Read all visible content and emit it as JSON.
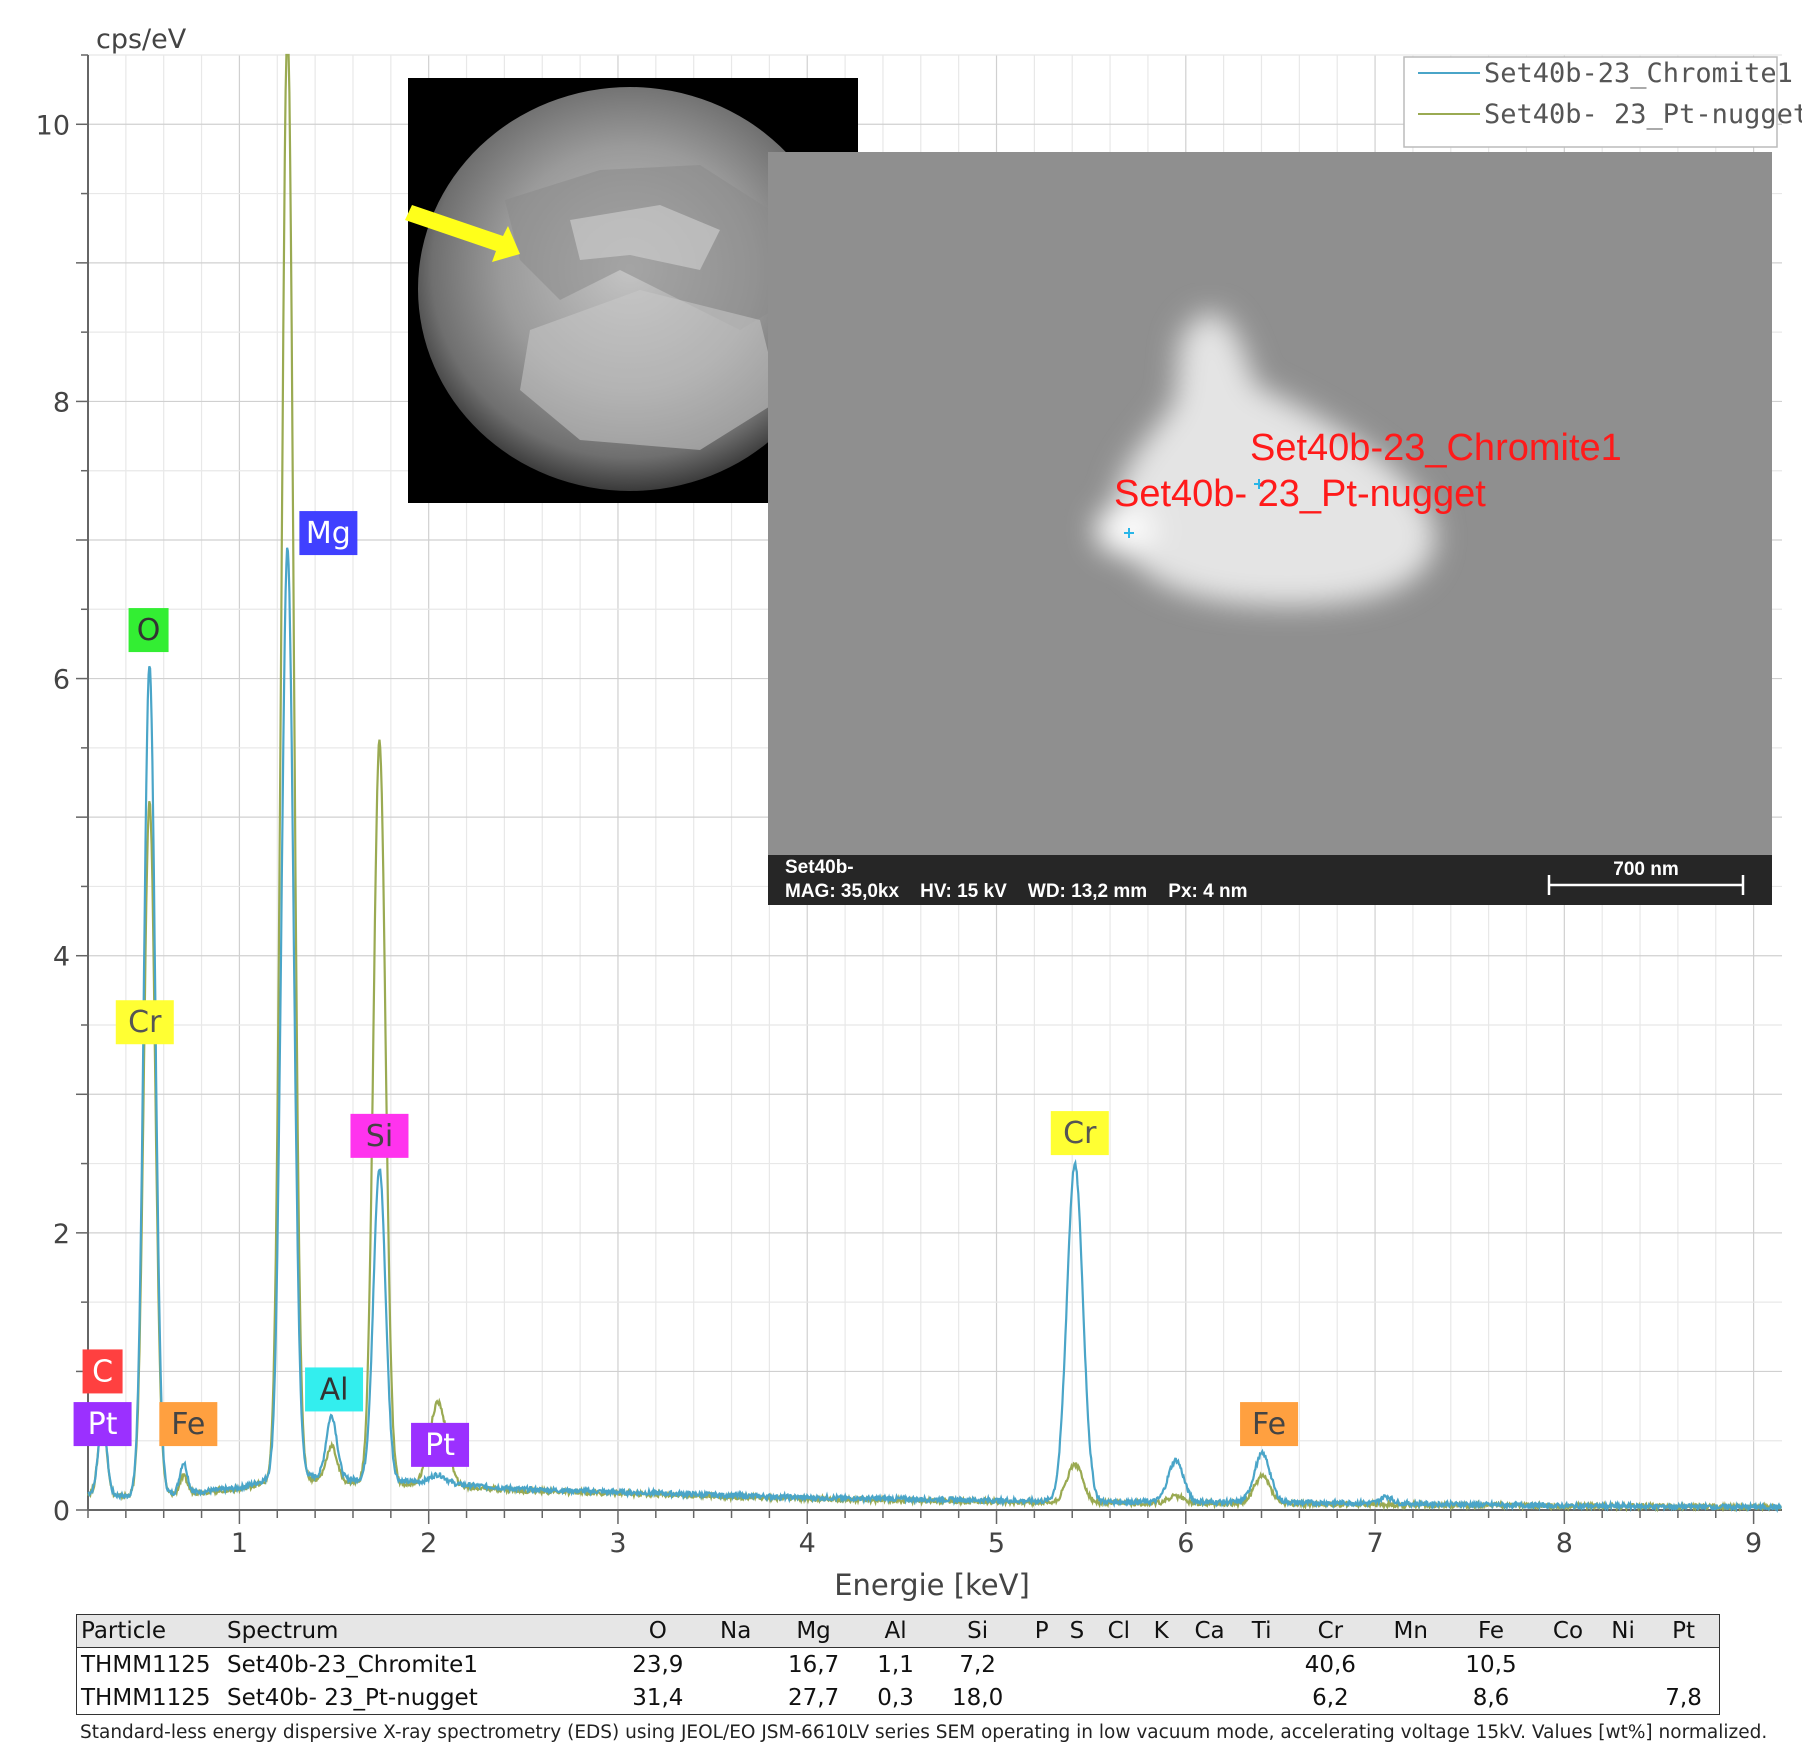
{
  "chart_data": {
    "type": "line",
    "xlabel": "Energie [keV]",
    "ylabel": "cps/eV",
    "xlim": [
      0.2,
      9.15
    ],
    "ylim": [
      0,
      10.5
    ],
    "x_ticks": [
      1,
      2,
      3,
      4,
      5,
      6,
      7,
      8,
      9
    ],
    "y_ticks": [
      0,
      2,
      4,
      6,
      8,
      10
    ],
    "grid": true,
    "legend_position": "top-right",
    "series": [
      {
        "name": "Set40b-23_Chromite1",
        "color": "#4aa5c8",
        "baseline": [
          [
            0.2,
            0.12
          ],
          [
            0.4,
            0.1
          ],
          [
            0.7,
            0.12
          ],
          [
            1.0,
            0.16
          ],
          [
            1.15,
            0.22
          ],
          [
            1.3,
            0.25
          ],
          [
            1.6,
            0.22
          ],
          [
            2.0,
            0.2
          ],
          [
            2.5,
            0.15
          ],
          [
            3.0,
            0.13
          ],
          [
            4.0,
            0.09
          ],
          [
            5.0,
            0.07
          ],
          [
            5.5,
            0.06
          ],
          [
            6.0,
            0.06
          ],
          [
            7.0,
            0.05
          ],
          [
            8.0,
            0.03
          ],
          [
            9.15,
            0.02
          ]
        ],
        "peaks": [
          {
            "x": 0.277,
            "h": 0.55,
            "w": 0.022
          },
          {
            "x": 0.525,
            "h": 6.0,
            "w": 0.03
          },
          {
            "x": 0.705,
            "h": 0.22,
            "w": 0.02
          },
          {
            "x": 1.254,
            "h": 6.7,
            "w": 0.032
          },
          {
            "x": 1.487,
            "h": 0.45,
            "w": 0.028
          },
          {
            "x": 1.74,
            "h": 2.25,
            "w": 0.032
          },
          {
            "x": 2.05,
            "h": 0.06,
            "w": 0.04
          },
          {
            "x": 5.414,
            "h": 2.43,
            "w": 0.042
          },
          {
            "x": 5.947,
            "h": 0.3,
            "w": 0.04
          },
          {
            "x": 6.404,
            "h": 0.35,
            "w": 0.042
          },
          {
            "x": 7.06,
            "h": 0.05,
            "w": 0.03
          }
        ]
      },
      {
        "name": "Set40b- 23_Pt-nugget",
        "color": "#9aaa52",
        "baseline": [
          [
            0.2,
            0.12
          ],
          [
            0.4,
            0.1
          ],
          [
            0.7,
            0.12
          ],
          [
            1.0,
            0.15
          ],
          [
            1.15,
            0.2
          ],
          [
            1.3,
            0.23
          ],
          [
            1.6,
            0.2
          ],
          [
            2.0,
            0.18
          ],
          [
            2.5,
            0.14
          ],
          [
            3.0,
            0.12
          ],
          [
            4.0,
            0.08
          ],
          [
            5.0,
            0.06
          ],
          [
            5.5,
            0.05
          ],
          [
            6.0,
            0.05
          ],
          [
            7.0,
            0.04
          ],
          [
            8.0,
            0.03
          ],
          [
            9.15,
            0.02
          ]
        ],
        "peaks": [
          {
            "x": 0.277,
            "h": 0.55,
            "w": 0.022
          },
          {
            "x": 0.525,
            "h": 5.0,
            "w": 0.03
          },
          {
            "x": 0.705,
            "h": 0.12,
            "w": 0.02
          },
          {
            "x": 1.254,
            "h": 10.5,
            "w": 0.032
          },
          {
            "x": 1.487,
            "h": 0.25,
            "w": 0.028
          },
          {
            "x": 1.74,
            "h": 5.35,
            "w": 0.032
          },
          {
            "x": 2.05,
            "h": 0.6,
            "w": 0.045
          },
          {
            "x": 5.414,
            "h": 0.28,
            "w": 0.042
          },
          {
            "x": 5.947,
            "h": 0.05,
            "w": 0.04
          },
          {
            "x": 6.404,
            "h": 0.2,
            "w": 0.042
          }
        ]
      }
    ],
    "annotations": [
      {
        "text": "C",
        "x": 0.277,
        "y": 1.0,
        "bg": "#ff4040",
        "fg": "#ffffff"
      },
      {
        "text": "Pt",
        "x": 0.277,
        "y": 0.62,
        "bg": "#9b30ff",
        "fg": "#ffffff"
      },
      {
        "text": "O",
        "x": 0.52,
        "y": 6.35,
        "bg": "#33ee33",
        "fg": "#333333"
      },
      {
        "text": "Cr",
        "x": 0.5,
        "y": 3.52,
        "bg": "#ffff33",
        "fg": "#555555"
      },
      {
        "text": "Fe",
        "x": 0.73,
        "y": 0.62,
        "bg": "#ffa040",
        "fg": "#444444"
      },
      {
        "text": "Mg",
        "x": 1.47,
        "y": 7.05,
        "bg": "#4040ff",
        "fg": "#ffffff"
      },
      {
        "text": "Al",
        "x": 1.5,
        "y": 0.87,
        "bg": "#33eeee",
        "fg": "#333333"
      },
      {
        "text": "Si",
        "x": 1.74,
        "y": 2.7,
        "bg": "#ff33ee",
        "fg": "#444444"
      },
      {
        "text": "Pt",
        "x": 2.06,
        "y": 0.47,
        "bg": "#9b30ff",
        "fg": "#ffffff"
      },
      {
        "text": "Cr",
        "x": 5.44,
        "y": 2.72,
        "bg": "#ffff33",
        "fg": "#555555"
      },
      {
        "text": "Fe",
        "x": 6.44,
        "y": 0.62,
        "bg": "#ffa040",
        "fg": "#444444"
      }
    ]
  },
  "sem_image": {
    "point_labels": [
      "Set40b-23_Chromite1",
      "Set40b- 23_Pt-nugget"
    ],
    "info_name": "Set40b-",
    "info_line": "MAG: 35,0kx    HV: 15 kV    WD: 13,2 mm    Px: 4 nm",
    "scale_bar": "700 nm"
  },
  "table": {
    "headers": [
      "Particle",
      "Spectrum",
      "O",
      "Na",
      "Mg",
      "Al",
      "Si",
      "P",
      "S",
      "Cl",
      "K",
      "Ca",
      "Ti",
      "Cr",
      "Mn",
      "Fe",
      "Co",
      "Ni",
      "Pt"
    ],
    "rows": [
      [
        "THMM1125",
        "Set40b-23_Chromite1",
        "23,9",
        "",
        "16,7",
        "1,1",
        "7,2",
        "",
        "",
        "",
        "",
        "",
        "",
        "40,6",
        "",
        "10,5",
        "",
        "",
        ""
      ],
      [
        "THMM1125",
        "Set40b- 23_Pt-nugget",
        "31,4",
        "",
        "27,7",
        "0,3",
        "18,0",
        "",
        "",
        "",
        "",
        "",
        "",
        "6,2",
        "",
        "8,6",
        "",
        "",
        "7,8"
      ]
    ]
  },
  "footnote": "Standard-less energy dispersive X-ray spectrometry (EDS) using JEOL/EO JSM-6610LV series SEM operating in low vacuum mode, accelerating voltage 15kV. Values [wt%] normalized."
}
